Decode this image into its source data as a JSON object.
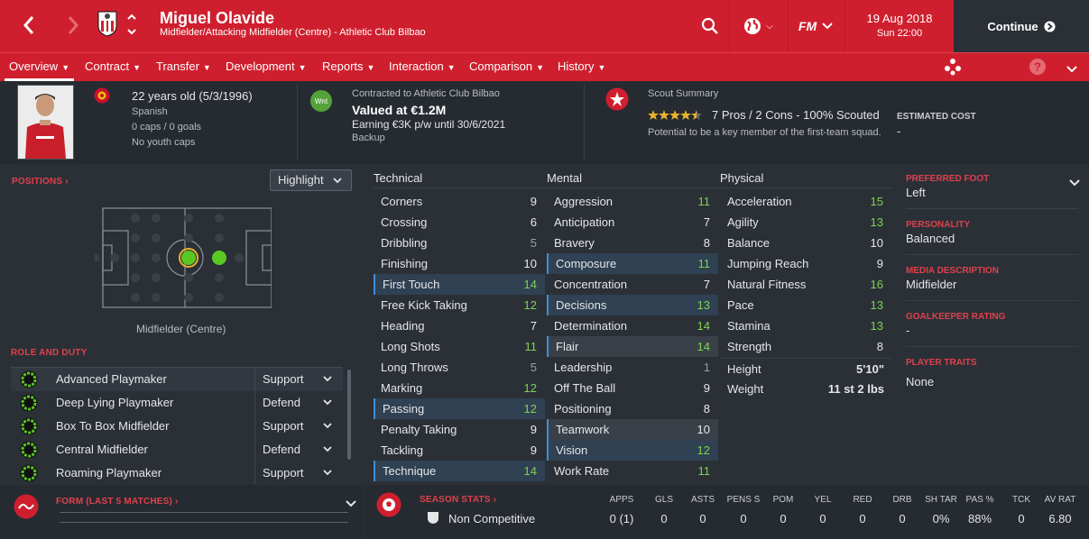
{
  "player": {
    "name": "Miguel Olavide",
    "subtitle": "Midfielder/Attacking Midfielder (Centre) - Athletic Club Bilbao",
    "age": "22 years old (5/3/1996)",
    "nationality": "Spanish",
    "caps": "0 caps / 0 goals",
    "youth_caps": "No youth caps",
    "contract_label": "Contracted to Athletic Club Bilbao",
    "value": "Valued at €1.2M",
    "earning": "Earning €3K p/w until 30/6/2021",
    "squad_status": "Backup",
    "wnt_badge": "Wnt"
  },
  "scout": {
    "title": "Scout Summary",
    "summary": "7 Pros / 2 Cons - 100% Scouted",
    "stars": 4.5,
    "potential": "Potential to be a key member of the first-team squad.",
    "cost_label": "ESTIMATED COST",
    "cost_value": "-"
  },
  "topbar": {
    "date": "19 Aug 2018",
    "time": "Sun 22:00",
    "continue": "Continue",
    "fm_label": "FM"
  },
  "tabs": [
    "Overview",
    "Contract",
    "Transfer",
    "Development",
    "Reports",
    "Interaction",
    "Comparison",
    "History"
  ],
  "positions": {
    "header": "POSITIONS",
    "highlight": "Highlight",
    "label": "Midfielder (Centre)"
  },
  "roles": {
    "header": "ROLE AND DUTY",
    "items": [
      {
        "name": "Advanced Playmaker",
        "duty": "Support"
      },
      {
        "name": "Deep Lying Playmaker",
        "duty": "Defend"
      },
      {
        "name": "Box To Box Midfielder",
        "duty": "Support"
      },
      {
        "name": "Central Midfielder",
        "duty": "Defend"
      },
      {
        "name": "Roaming Playmaker",
        "duty": "Support"
      }
    ]
  },
  "attributes": {
    "technical_title": "Technical",
    "mental_title": "Mental",
    "physical_title": "Physical",
    "technical": [
      {
        "name": "Corners",
        "value": "9"
      },
      {
        "name": "Crossing",
        "value": "6"
      },
      {
        "name": "Dribbling",
        "value": "5"
      },
      {
        "name": "Finishing",
        "value": "10"
      },
      {
        "name": "First Touch",
        "value": "14"
      },
      {
        "name": "Free Kick Taking",
        "value": "12"
      },
      {
        "name": "Heading",
        "value": "7"
      },
      {
        "name": "Long Shots",
        "value": "11"
      },
      {
        "name": "Long Throws",
        "value": "5"
      },
      {
        "name": "Marking",
        "value": "12"
      },
      {
        "name": "Passing",
        "value": "12"
      },
      {
        "name": "Penalty Taking",
        "value": "9"
      },
      {
        "name": "Tackling",
        "value": "9"
      },
      {
        "name": "Technique",
        "value": "14"
      }
    ],
    "mental": [
      {
        "name": "Aggression",
        "value": "11"
      },
      {
        "name": "Anticipation",
        "value": "7"
      },
      {
        "name": "Bravery",
        "value": "8"
      },
      {
        "name": "Composure",
        "value": "11"
      },
      {
        "name": "Concentration",
        "value": "7"
      },
      {
        "name": "Decisions",
        "value": "13"
      },
      {
        "name": "Determination",
        "value": "14"
      },
      {
        "name": "Flair",
        "value": "14"
      },
      {
        "name": "Leadership",
        "value": "1"
      },
      {
        "name": "Off The Ball",
        "value": "9"
      },
      {
        "name": "Positioning",
        "value": "8"
      },
      {
        "name": "Teamwork",
        "value": "10"
      },
      {
        "name": "Vision",
        "value": "12"
      },
      {
        "name": "Work Rate",
        "value": "11"
      }
    ],
    "physical": [
      {
        "name": "Acceleration",
        "value": "15"
      },
      {
        "name": "Agility",
        "value": "13"
      },
      {
        "name": "Balance",
        "value": "10"
      },
      {
        "name": "Jumping Reach",
        "value": "9"
      },
      {
        "name": "Natural Fitness",
        "value": "16"
      },
      {
        "name": "Pace",
        "value": "13"
      },
      {
        "name": "Stamina",
        "value": "13"
      },
      {
        "name": "Strength",
        "value": "8"
      }
    ],
    "height_label": "Height",
    "height": "5'10\"",
    "weight_label": "Weight",
    "weight": "11 st 2 lbs"
  },
  "right_panel": {
    "foot_label": "PREFERRED FOOT",
    "foot": "Left",
    "personality_label": "PERSONALITY",
    "personality": "Balanced",
    "media_label": "MEDIA DESCRIPTION",
    "media": "Midfielder",
    "gk_label": "GOALKEEPER RATING",
    "gk": "-",
    "traits_label": "PLAYER TRAITS",
    "traits": "None"
  },
  "form": {
    "header": "FORM (LAST 5 MATCHES)"
  },
  "season": {
    "header": "SEASON STATS",
    "row_label": "Non Competitive",
    "columns": [
      "APPS",
      "GLS",
      "ASTS",
      "PENS S",
      "POM",
      "YEL",
      "RED",
      "DRB",
      "SH TAR",
      "PAS %",
      "TCK",
      "AV RAT"
    ],
    "values": [
      "0 (1)",
      "0",
      "0",
      "0",
      "0",
      "0",
      "0",
      "0",
      "0%",
      "88%",
      "0",
      "6.80"
    ]
  },
  "colors": {
    "accent": "#cf1f2e",
    "good": "#7dd34f",
    "bg": "#2b3037"
  }
}
